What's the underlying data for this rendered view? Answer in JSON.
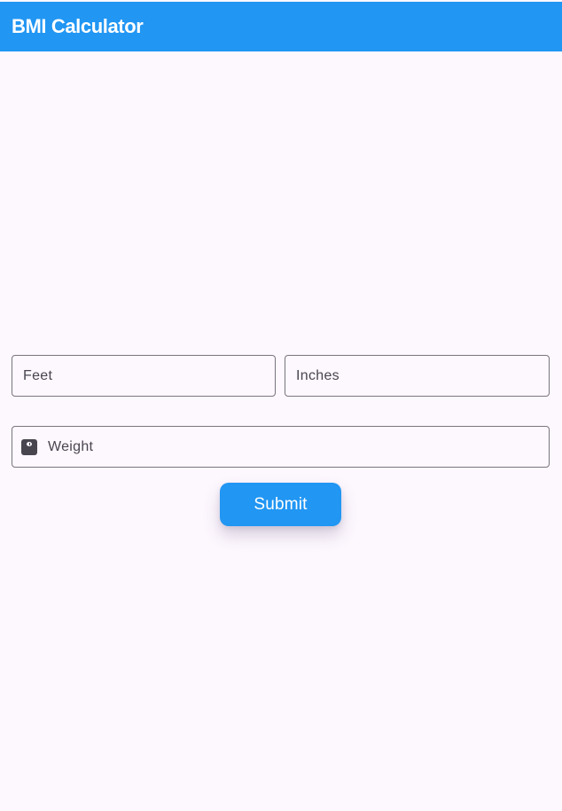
{
  "app_bar": {
    "title": "BMI Calculator"
  },
  "form": {
    "feet": {
      "placeholder": "Feet",
      "value": ""
    },
    "inches": {
      "placeholder": "Inches",
      "value": ""
    },
    "weight": {
      "placeholder": "Weight",
      "value": "",
      "icon": "scale-icon"
    },
    "submit_label": "Submit"
  },
  "colors": {
    "primary": "#2196f3",
    "background": "#fdf7fe",
    "outline": "#79747e",
    "label": "#49454f"
  }
}
